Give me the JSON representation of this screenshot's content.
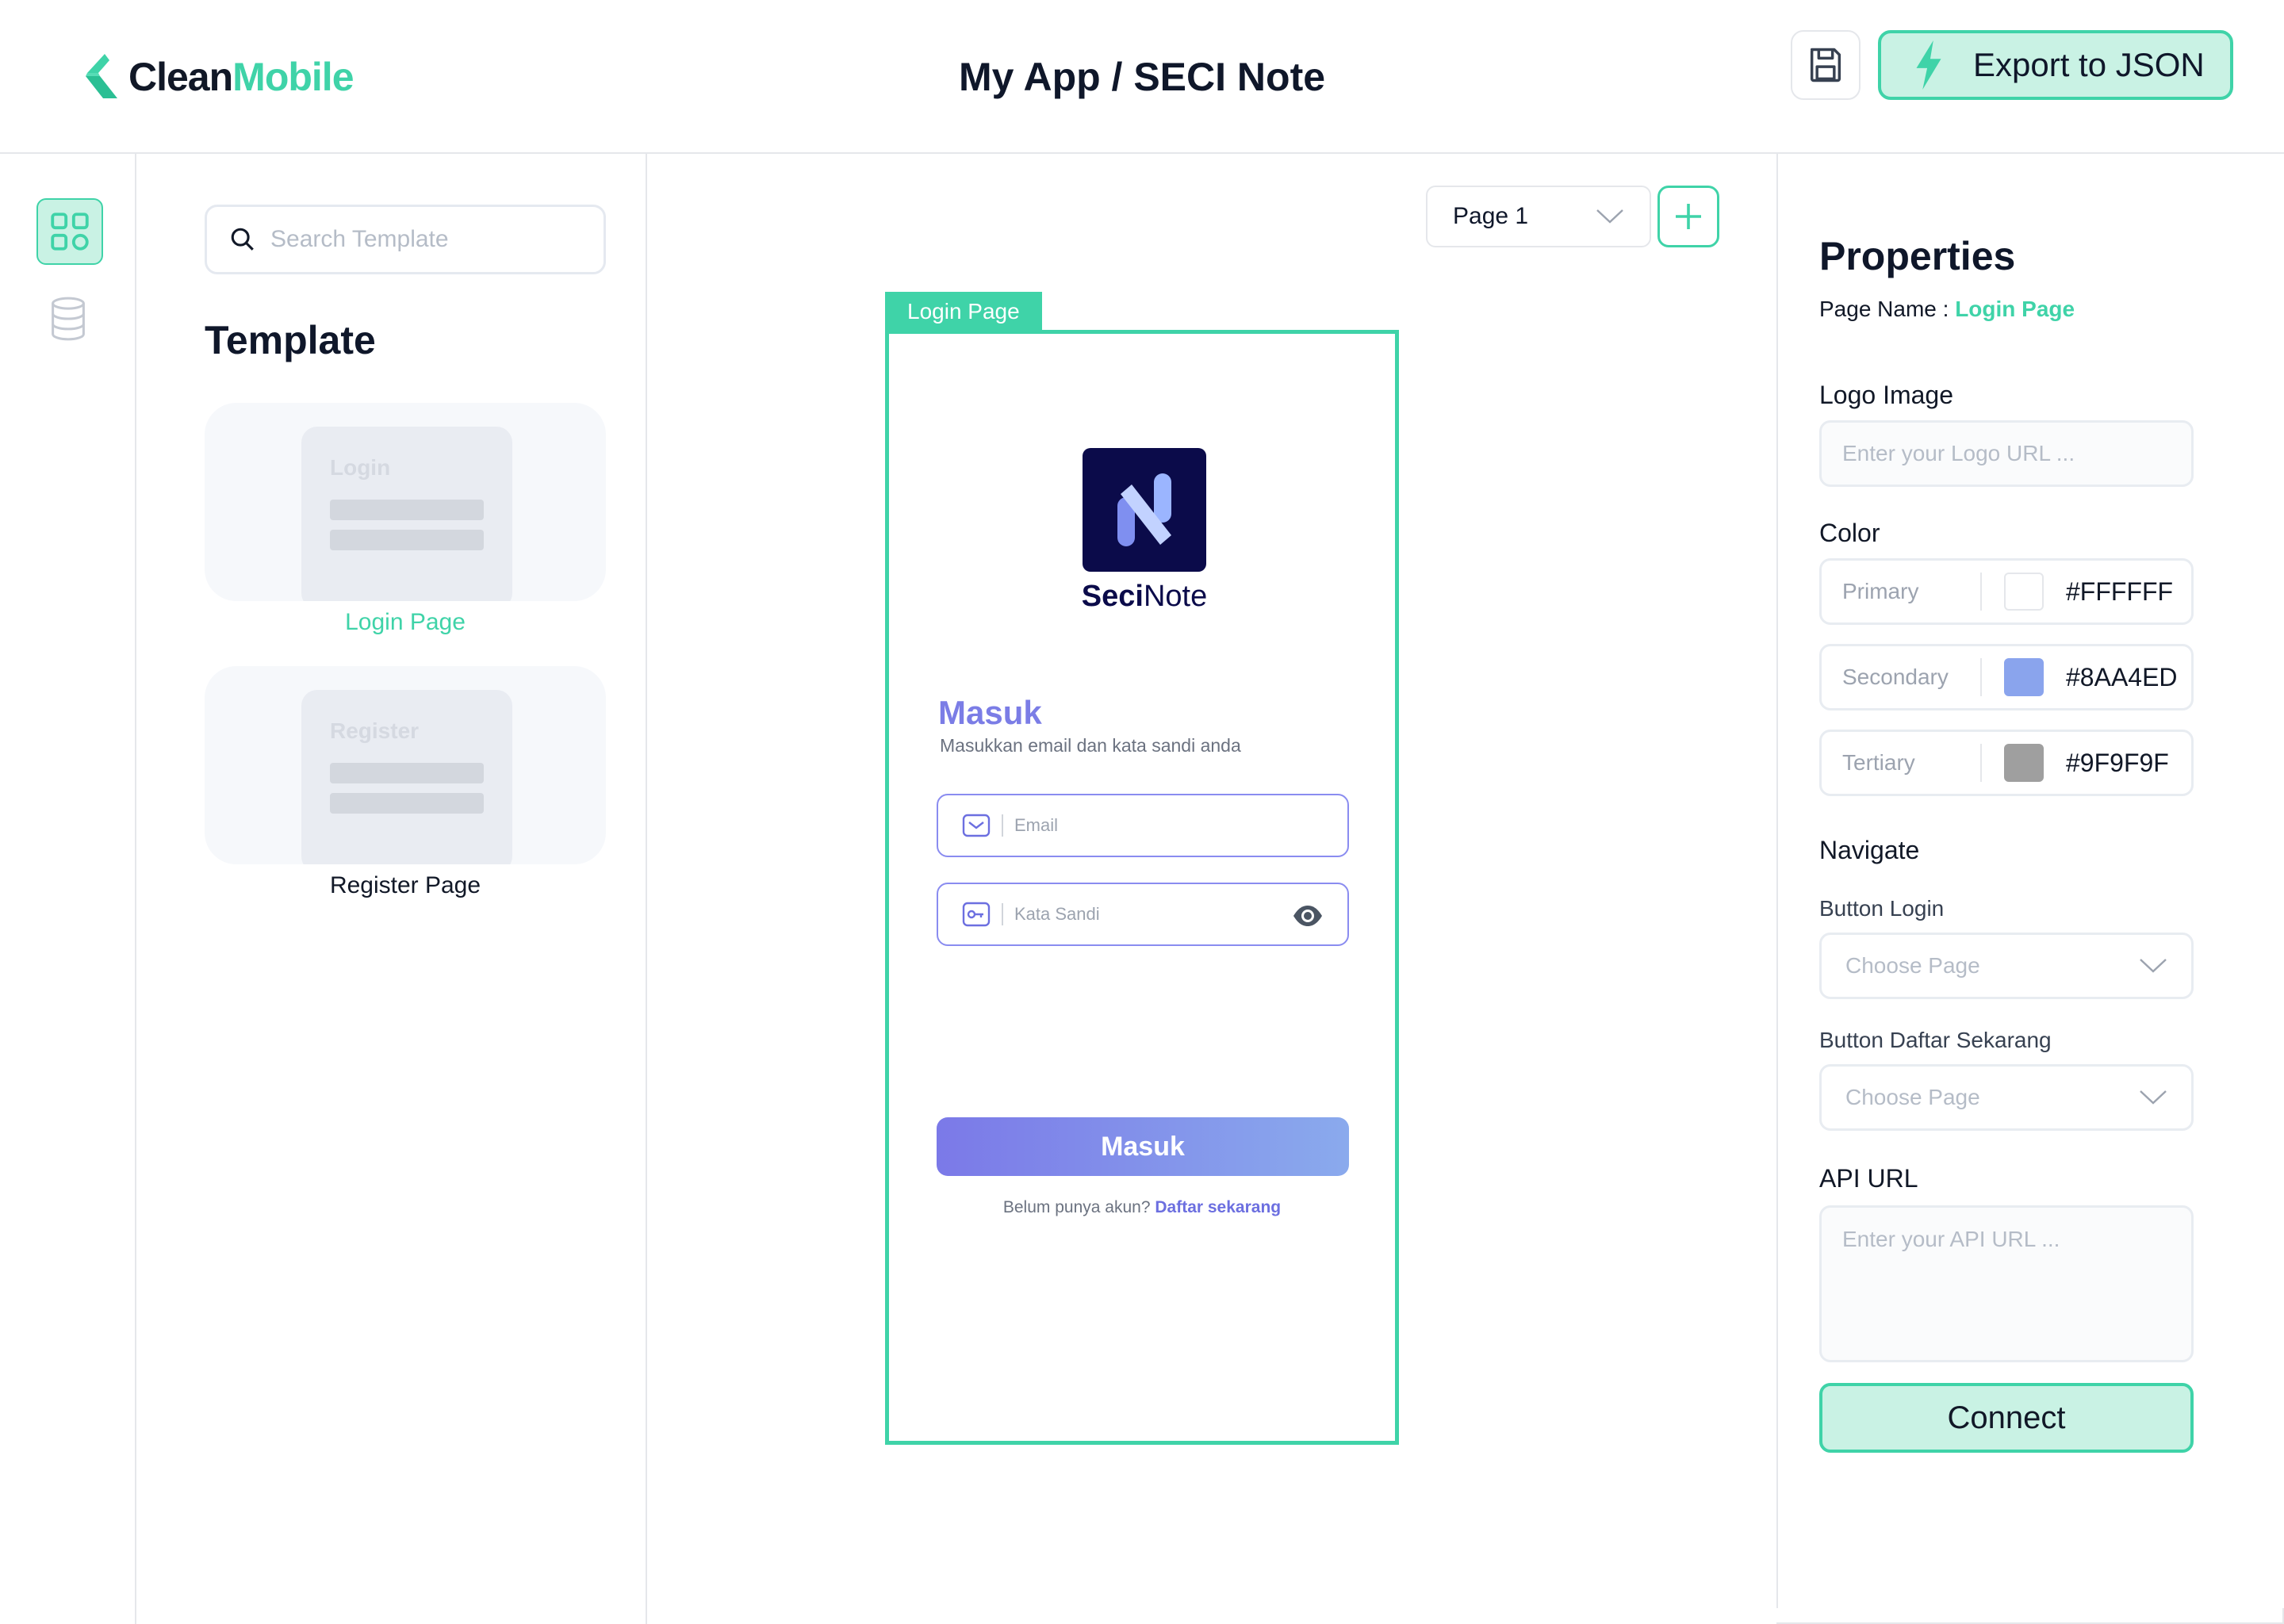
{
  "brand": {
    "part1": "Clean",
    "part2": "Mobile",
    "accent": "#3fd3a8"
  },
  "header": {
    "title": "My App / SECI Note",
    "export_label": "Export to JSON"
  },
  "sidebar": {
    "icons": [
      "grid-icon",
      "database-icon"
    ]
  },
  "templates": {
    "search_placeholder": "Search Template",
    "heading": "Template",
    "items": [
      {
        "thumb_title": "Login",
        "caption": "Login Page",
        "selected": true
      },
      {
        "thumb_title": "Register",
        "caption": "Register Page",
        "selected": false
      }
    ]
  },
  "canvas": {
    "page_select": "Page 1",
    "frame_label": "Login Page",
    "app": {
      "name_bold": "Seci",
      "name_rest": "Note",
      "heading": "Masuk",
      "subheading": "Masukkan email dan kata sandi anda",
      "email_placeholder": "Email",
      "password_placeholder": "Kata Sandi",
      "button": "Masuk",
      "footer_text": "Belum punya akun?",
      "footer_link": "Daftar sekarang"
    }
  },
  "properties": {
    "heading": "Properties",
    "page_name_label": "Page Name :",
    "page_name_value": "Login Page",
    "logo_label": "Logo Image",
    "logo_placeholder": "Enter your Logo URL ...",
    "color_label": "Color",
    "colors": [
      {
        "name": "Primary",
        "hex": "#FFFFFF"
      },
      {
        "name": "Secondary",
        "hex": "#8AA4ED"
      },
      {
        "name": "Tertiary",
        "hex": "#9F9F9F"
      }
    ],
    "navigate_label": "Navigate",
    "nav_login_label": "Button Login",
    "nav_login_value": "Choose Page",
    "nav_daftar_label": "Button Daftar Sekarang",
    "nav_daftar_value": "Choose Page",
    "api_label": "API URL",
    "api_placeholder": "Enter your API URL ...",
    "connect_label": "Connect"
  }
}
